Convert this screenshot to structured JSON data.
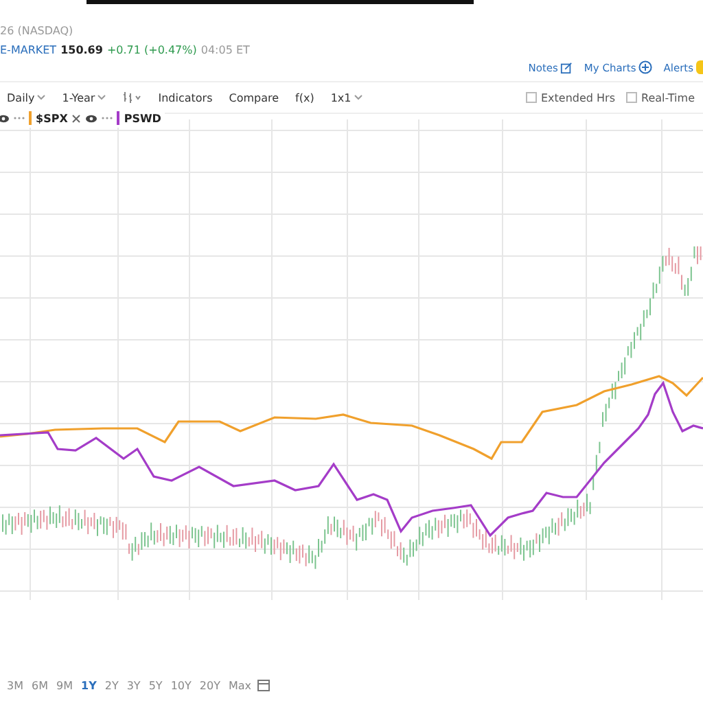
{
  "quote": {
    "exchange": "26 (NASDAQ)",
    "session": "E-MARKET",
    "price": "150.69",
    "change": "+0.71 (+0.47%)",
    "time": "04:05 ET"
  },
  "links": [
    {
      "label": "Notes",
      "kind": "notes"
    },
    {
      "label": "My Charts",
      "kind": "add"
    },
    {
      "label": "Alerts",
      "kind": "alerts"
    }
  ],
  "toolbar": [
    {
      "label": "Daily",
      "kind": "dropdown"
    },
    {
      "label": "1-Year",
      "kind": "dropdown"
    },
    {
      "kind": "chart-type"
    },
    {
      "label": "Indicators",
      "kind": "button"
    },
    {
      "label": "Compare",
      "kind": "button"
    },
    {
      "label": "f(x)",
      "kind": "button"
    },
    {
      "label": "1x1",
      "kind": "dropdown"
    }
  ],
  "options": [
    {
      "label": "Extended Hrs",
      "checked": false
    },
    {
      "label": "Real-Time",
      "checked": false
    }
  ],
  "legend": [
    {
      "symbol": "$SPX",
      "color": "#f0a02c"
    },
    {
      "symbol": "PSWD",
      "color": "#a43cc8"
    }
  ],
  "ranges": [
    {
      "label": "3M",
      "selected": false
    },
    {
      "label": "6M",
      "selected": false
    },
    {
      "label": "9M",
      "selected": false
    },
    {
      "label": "1Y",
      "selected": true
    },
    {
      "label": "2Y",
      "selected": false
    },
    {
      "label": "3Y",
      "selected": false
    },
    {
      "label": "5Y",
      "selected": false
    },
    {
      "label": "10Y",
      "selected": false
    },
    {
      "label": "20Y",
      "selected": false
    },
    {
      "label": "Max",
      "selected": false
    }
  ]
}
